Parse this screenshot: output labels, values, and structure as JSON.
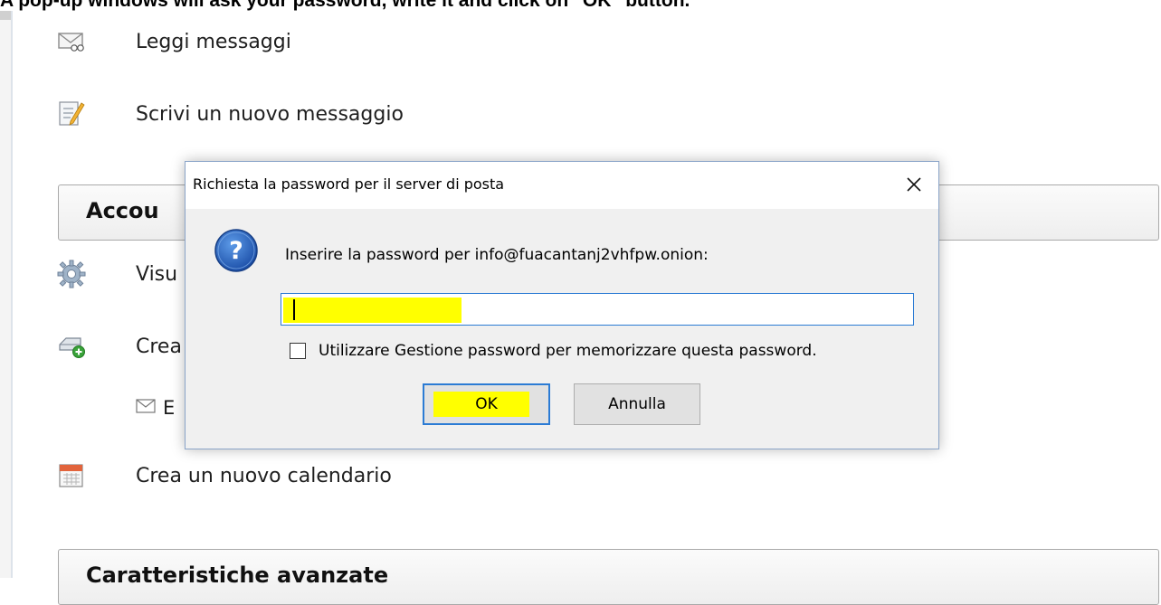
{
  "banner": {
    "text": "A pop-up windows will ask your password, write it and click on \"OK\" button."
  },
  "menu": {
    "items": [
      {
        "label": "Leggi messaggi",
        "icon": "envelope-glasses-icon"
      },
      {
        "label": "Scrivi un nuovo messaggio",
        "icon": "write-message-icon"
      }
    ],
    "accounts_section": {
      "title": "Accou",
      "items": [
        {
          "label": "Visu",
          "icon": "gear-icon"
        },
        {
          "label": "Crea",
          "icon": "new-account-icon"
        },
        {
          "label": "E",
          "icon": "envelope-icon"
        }
      ]
    },
    "calendar_item": {
      "label": "Crea un nuovo calendario",
      "icon": "calendar-icon"
    },
    "advanced_section": {
      "title": "Caratteristiche avanzate"
    }
  },
  "dialog": {
    "title": "Richiesta la password per il server di posta",
    "prompt": "Inserire la password per info@fuacantanj2vhfpw.onion:",
    "password_value": "",
    "checkbox_label": "Utilizzare Gestione password per memorizzare questa password.",
    "checkbox_checked": false,
    "ok_label": "OK",
    "cancel_label": "Annulla",
    "close_glyph": "✕"
  },
  "colors": {
    "highlight": "#ffff00",
    "focus_border": "#2b7bd4",
    "dialog_bg": "#f0f0f0",
    "question_icon": "#1f5fb4"
  }
}
